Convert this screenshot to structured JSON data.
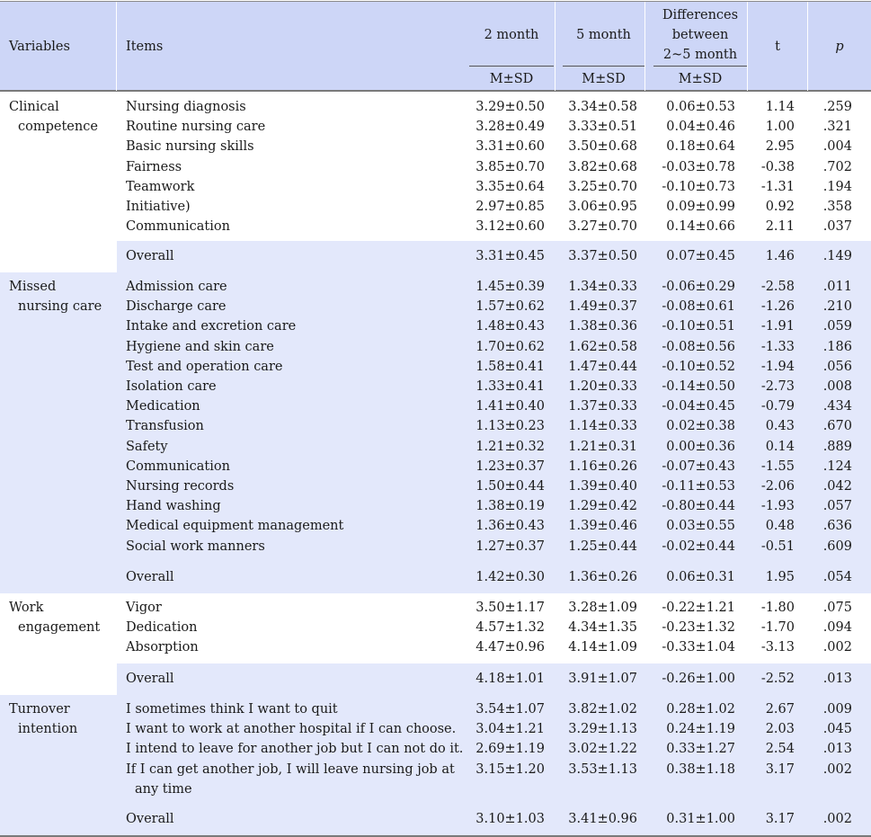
{
  "header": {
    "variables": "Variables",
    "items": "Items",
    "m2": "2 month",
    "m5": "5 month",
    "diff_line1": "Differences",
    "diff_line2": "between",
    "diff_line3": "2~5 month",
    "t": "t",
    "p": "p",
    "msd": "M±SD"
  },
  "groups": [
    {
      "name_line1": "Clinical",
      "name_line2": "competence",
      "rows": [
        {
          "item": "Nursing diagnosis",
          "m2": "3.29±0.50",
          "m5": "3.34±0.58",
          "diff": "0.06±0.53",
          "t": "1.14",
          "p": ".259"
        },
        {
          "item": "Routine nursing care",
          "m2": "3.28±0.49",
          "m5": "3.33±0.51",
          "diff": "0.04±0.46",
          "t": "1.00",
          "p": ".321"
        },
        {
          "item": "Basic nursing skills",
          "m2": "3.31±0.60",
          "m5": "3.50±0.68",
          "diff": "0.18±0.64",
          "t": "2.95",
          "p": ".004"
        },
        {
          "item": "Fairness",
          "m2": "3.85±0.70",
          "m5": "3.82±0.68",
          "diff": "-0.03±0.78",
          "t": "-0.38",
          "p": ".702"
        },
        {
          "item": "Teamwork",
          "m2": "3.35±0.64",
          "m5": "3.25±0.70",
          "diff": "-0.10±0.73",
          "t": "-1.31",
          "p": ".194"
        },
        {
          "item": "Initiative)",
          "m2": "2.97±0.85",
          "m5": "3.06±0.95",
          "diff": "0.09±0.99",
          "t": "0.92",
          "p": ".358"
        },
        {
          "item": "Communication",
          "m2": "3.12±0.60",
          "m5": "3.27±0.70",
          "diff": "0.14±0.66",
          "t": "2.11",
          "p": ".037"
        }
      ],
      "overall": {
        "item": "Overall",
        "m2": "3.31±0.45",
        "m5": "3.37±0.50",
        "diff": "0.07±0.45",
        "t": "1.46",
        "p": ".149"
      }
    },
    {
      "name_line1": "Missed",
      "name_line2": "nursing care",
      "rows": [
        {
          "item": "Admission care",
          "m2": "1.45±0.39",
          "m5": "1.34±0.33",
          "diff": "-0.06±0.29",
          "t": "-2.58",
          "p": ".011"
        },
        {
          "item": "Discharge care",
          "m2": "1.57±0.62",
          "m5": "1.49±0.37",
          "diff": "-0.08±0.61",
          "t": "-1.26",
          "p": ".210"
        },
        {
          "item": "Intake and excretion care",
          "m2": "1.48±0.43",
          "m5": "1.38±0.36",
          "diff": "-0.10±0.51",
          "t": "-1.91",
          "p": ".059"
        },
        {
          "item": "Hygiene and skin care",
          "m2": "1.70±0.62",
          "m5": "1.62±0.58",
          "diff": "-0.08±0.56",
          "t": "-1.33",
          "p": ".186"
        },
        {
          "item": "Test and operation care",
          "m2": "1.58±0.41",
          "m5": "1.47±0.44",
          "diff": "-0.10±0.52",
          "t": "-1.94",
          "p": ".056"
        },
        {
          "item": "Isolation care",
          "m2": "1.33±0.41",
          "m5": "1.20±0.33",
          "diff": "-0.14±0.50",
          "t": "-2.73",
          "p": ".008"
        },
        {
          "item": "Medication",
          "m2": "1.41±0.40",
          "m5": "1.37±0.33",
          "diff": "-0.04±0.45",
          "t": "-0.79",
          "p": ".434"
        },
        {
          "item": "Transfusion",
          "m2": "1.13±0.23",
          "m5": "1.14±0.33",
          "diff": "0.02±0.38",
          "t": "0.43",
          "p": ".670"
        },
        {
          "item": "Safety",
          "m2": "1.21±0.32",
          "m5": "1.21±0.31",
          "diff": "0.00±0.36",
          "t": "0.14",
          "p": ".889"
        },
        {
          "item": "Communication",
          "m2": "1.23±0.37",
          "m5": "1.16±0.26",
          "diff": "-0.07±0.43",
          "t": "-1.55",
          "p": ".124"
        },
        {
          "item": "Nursing records",
          "m2": "1.50±0.44",
          "m5": "1.39±0.40",
          "diff": "-0.11±0.53",
          "t": "-2.06",
          "p": ".042"
        },
        {
          "item": "Hand washing",
          "m2": "1.38±0.19",
          "m5": "1.29±0.42",
          "diff": "-0.80±0.44",
          "t": "-1.93",
          "p": ".057"
        },
        {
          "item": "Medical equipment management",
          "m2": "1.36±0.43",
          "m5": "1.39±0.46",
          "diff": "0.03±0.55",
          "t": "0.48",
          "p": ".636"
        },
        {
          "item": "Social work manners",
          "m2": "1.27±0.37",
          "m5": "1.25±0.44",
          "diff": "-0.02±0.44",
          "t": "-0.51",
          "p": ".609"
        }
      ],
      "overall": {
        "item": "Overall",
        "m2": "1.42±0.30",
        "m5": "1.36±0.26",
        "diff": "0.06±0.31",
        "t": "1.95",
        "p": ".054"
      }
    },
    {
      "name_line1": "Work",
      "name_line2": "engagement",
      "rows": [
        {
          "item": "Vigor",
          "m2": "3.50±1.17",
          "m5": "3.28±1.09",
          "diff": "-0.22±1.21",
          "t": "-1.80",
          "p": ".075"
        },
        {
          "item": "Dedication",
          "m2": "4.57±1.32",
          "m5": "4.34±1.35",
          "diff": "-0.23±1.32",
          "t": "-1.70",
          "p": ".094"
        },
        {
          "item": "Absorption",
          "m2": "4.47±0.96",
          "m5": "4.14±1.09",
          "diff": "-0.33±1.04",
          "t": "-3.13",
          "p": ".002"
        }
      ],
      "overall": {
        "item": "Overall",
        "m2": "4.18±1.01",
        "m5": "3.91±1.07",
        "diff": "-0.26±1.00",
        "t": "-2.52",
        "p": ".013"
      }
    },
    {
      "name_line1": "Turnover",
      "name_line2": "intention",
      "rows": [
        {
          "item": "I sometimes think I want to quit",
          "m2": "3.54±1.07",
          "m5": "3.82±1.02",
          "diff": "0.28±1.02",
          "t": "2.67",
          "p": ".009"
        },
        {
          "item": "I want to work at another hospital if I can choose.",
          "m2": "3.04±1.21",
          "m5": "3.29±1.13",
          "diff": "0.24±1.19",
          "t": "2.03",
          "p": ".045"
        },
        {
          "item": "I intend to leave for another job but I can not do it.",
          "m2": "2.69±1.19",
          "m5": "3.02±1.22",
          "diff": "0.33±1.27",
          "t": "2.54",
          "p": ".013"
        },
        {
          "item": "If I can get another job, I will leave nursing job at",
          "item_cont": "any time",
          "m2": "3.15±1.20",
          "m5": "3.53±1.13",
          "diff": "0.38±1.18",
          "t": "3.17",
          "p": ".002"
        }
      ],
      "overall": {
        "item": "Overall",
        "m2": "3.10±1.03",
        "m5": "3.41±0.96",
        "diff": "0.31±1.00",
        "t": "3.17",
        "p": ".002"
      }
    }
  ]
}
